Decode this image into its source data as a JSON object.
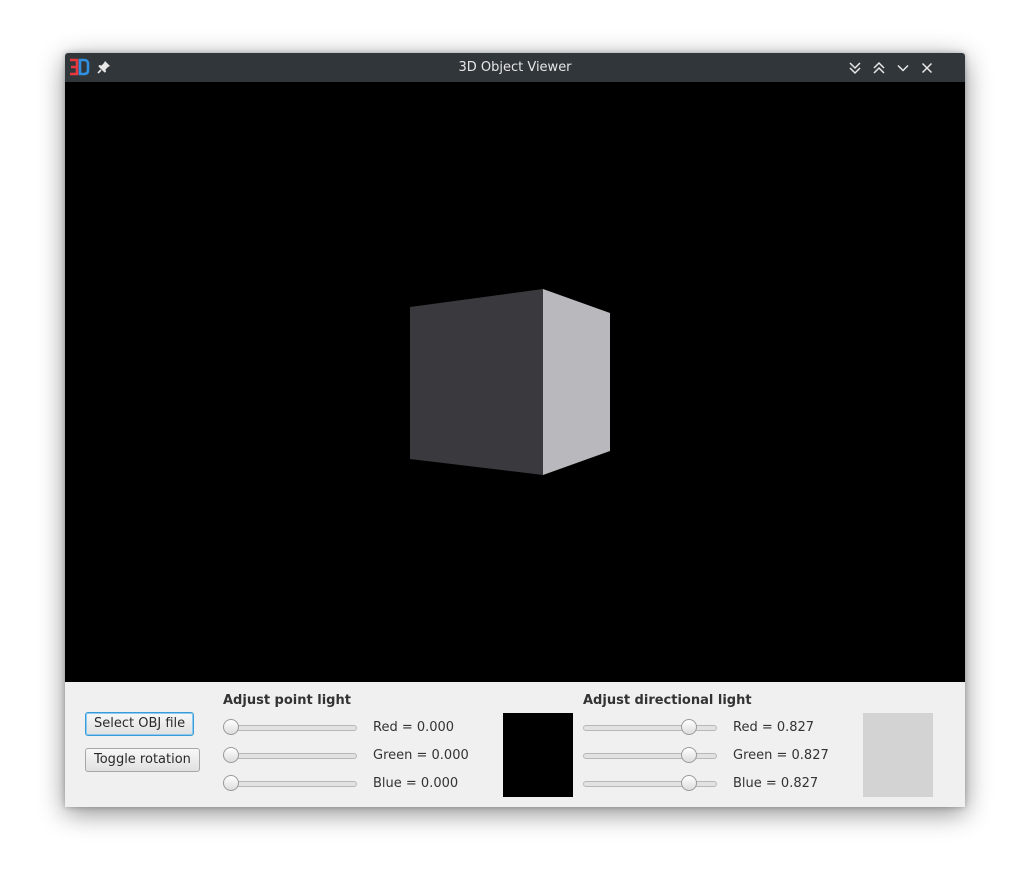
{
  "window": {
    "title": "3D Object Viewer",
    "app_icon_name": "app-3d-icon",
    "title_bar_color": "#31363b"
  },
  "titlebar_buttons": [
    "keep-below-icon",
    "keep-above-icon",
    "minimize-icon",
    "close-icon"
  ],
  "viewport": {
    "background": "#000000",
    "object": "cube"
  },
  "buttons": {
    "select_obj": "Select OBJ file",
    "toggle_rotation": "Toggle rotation"
  },
  "point_light": {
    "heading": "Adjust point light",
    "red": {
      "text": "Red = 0.000",
      "value": 0.0
    },
    "green": {
      "text": "Green = 0.000",
      "value": 0.0
    },
    "blue": {
      "text": "Blue = 0.000",
      "value": 0.0
    },
    "swatch_color": "#000000"
  },
  "directional_light": {
    "heading": "Adjust directional light",
    "red": {
      "text": "Red = 0.827",
      "value": 0.827
    },
    "green": {
      "text": "Green = 0.827",
      "value": 0.827
    },
    "blue": {
      "text": "Blue = 0.827",
      "value": 0.827
    },
    "swatch_color": "#d3d3d3"
  }
}
